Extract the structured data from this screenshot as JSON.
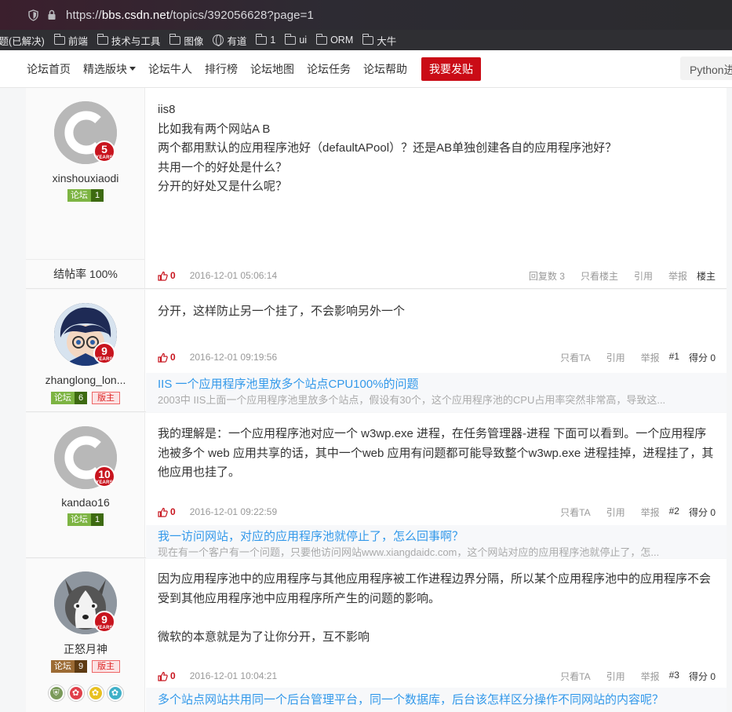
{
  "browser": {
    "url_prefix": "https://",
    "url_host": "bbs.csdn.net",
    "url_path": "/topics/392056628?page=1",
    "bookmarks": [
      {
        "label": "问题(已解决)",
        "icon": "none"
      },
      {
        "label": "前端",
        "icon": "folder"
      },
      {
        "label": "技术与工具",
        "icon": "folder"
      },
      {
        "label": "图像",
        "icon": "folder"
      },
      {
        "label": "有道",
        "icon": "globe"
      },
      {
        "label": "1",
        "icon": "folder"
      },
      {
        "label": "ui",
        "icon": "folder"
      },
      {
        "label": "ORM",
        "icon": "folder"
      },
      {
        "label": "大牛",
        "icon": "folder"
      }
    ]
  },
  "nav": {
    "items": [
      "论坛首页",
      "精选版块",
      "论坛牛人",
      "排行榜",
      "论坛地图",
      "论坛任务",
      "论坛帮助"
    ],
    "post_button": "我要发贴",
    "search_text": "Python进阶"
  },
  "colors": {
    "brand_red": "#ca0c16",
    "link_blue": "#3399ea"
  },
  "posts": [
    {
      "username": "xinshouxiaodi",
      "years": "5",
      "years_label": "YEARS",
      "level_key": "论坛",
      "level_val": "1",
      "rate": "结帖率 100%",
      "body": [
        "iis8",
        "比如我有两个网站A B",
        "两个都用默认的应用程序池好（defaultAPool）？还是AB单独创建各自的应用程序池好？",
        "共用一个的好处是什么？",
        "分开的好处又是什么呢？"
      ],
      "likes": "0",
      "time": "2016-12-01 05:06:14",
      "reply_label": "回复数",
      "reply_count": "3",
      "actions": [
        "只看楼主",
        "引用",
        "举报"
      ],
      "floor": "楼主"
    },
    {
      "username": "zhanglong_lon...",
      "years": "9",
      "years_label": "YEARS",
      "level_key": "论坛",
      "level_val": "6",
      "moderator": "版主",
      "body": [
        "分开，这样防止另一个挂了，不会影响另外一个"
      ],
      "likes": "0",
      "time": "2016-12-01 09:19:56",
      "actions": [
        "只看TA",
        "引用",
        "举报"
      ],
      "floor": "#1",
      "score": "得分 0",
      "related_title": "IIS 一个应用程序池里放多个站点CPU100%的问题",
      "related_desc": "2003中 IIS上面一个应用程序池里放多个站点，假设有30个，这个应用程序池的CPU占用率突然非常高，导致这..."
    },
    {
      "username": "kandao16",
      "years": "10",
      "years_label": "YEARS",
      "level_key": "论坛",
      "level_val": "1",
      "body": [
        "我的理解是：一个应用程序池对应一个 w3wp.exe 进程，在任务管理器-进程 下面可以看到。一个应用程序池被多个 web 应用共享的话，其中一个web 应用有问题都可能导致整个w3wp.exe 进程挂掉，进程挂了，其他应用也挂了。"
      ],
      "likes": "0",
      "time": "2016-12-01 09:22:59",
      "actions": [
        "只看TA",
        "引用",
        "举报"
      ],
      "floor": "#2",
      "score": "得分 0",
      "related_title": "我一访问网站，对应的应用程序池就停止了，怎么回事啊？",
      "related_desc": "现在有一个客户有一个问题，只要他访问网站www.xiangdaidc.com，这个网站对应的应用程序池就停止了，怎..."
    },
    {
      "username": "正怒月神",
      "years": "9",
      "years_label": "YEARS",
      "level_key": "论坛",
      "level_val": "9",
      "moderator": "版主",
      "body": [
        "因为应用程序池中的应用程序与其他应用程序被工作进程边界分隔，所以某个应用程序池中的应用程序不会受到其他应用程序池中应用程序所产生的问题的影响。",
        "",
        "微软的本意就是为了让你分开，互不影响"
      ],
      "likes": "0",
      "time": "2016-12-01 10:04:21",
      "actions": [
        "只看TA",
        "引用",
        "举报"
      ],
      "floor": "#3",
      "score": "得分 0",
      "related_title": "多个站点网站共用同一个后台管理平台，同一个数据库，后台该怎样区分操作不同网站的内容呢？",
      "medals": [
        {
          "icon": "shield-medal",
          "color": "#7a9a5a"
        },
        {
          "icon": "flower-medal",
          "color": "#e0404a"
        },
        {
          "icon": "flower-medal",
          "color": "#e8c020"
        },
        {
          "icon": "flower-medal",
          "color": "#40b0c8"
        }
      ]
    }
  ]
}
